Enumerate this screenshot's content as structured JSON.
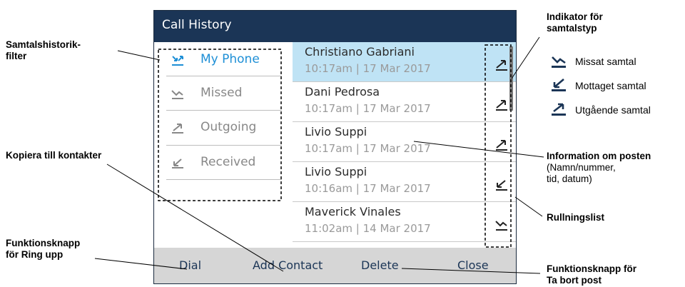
{
  "screen": {
    "title": "Call History",
    "filters": [
      {
        "label": "My Phone",
        "icon": "all-calls-icon",
        "active": true
      },
      {
        "label": "Missed",
        "icon": "missed-call-icon",
        "active": false
      },
      {
        "label": "Outgoing",
        "icon": "outgoing-call-icon",
        "active": false
      },
      {
        "label": "Received",
        "icon": "received-call-icon",
        "active": false
      }
    ],
    "entries": [
      {
        "name": "Christiano Gabriani",
        "time": "10:17am | 17 Mar 2017",
        "type": "outgoing-call-icon"
      },
      {
        "name": "Dani Pedrosa",
        "time": "10:17am | 17 Mar 2017",
        "type": "outgoing-call-icon"
      },
      {
        "name": "Livio Suppi",
        "time": "10:17am | 17 Mar 2017",
        "type": "outgoing-call-icon"
      },
      {
        "name": "Livio Suppi",
        "time": "10:16am | 17 Mar 2017",
        "type": "received-call-icon"
      },
      {
        "name": "Maverick Vinales",
        "time": "11:02am | 14 Mar 2017",
        "type": "missed-call-icon"
      }
    ],
    "softkeys": {
      "dial": "Dial",
      "add_contact": "Add Contact",
      "delete": "Delete",
      "close": "Close"
    },
    "colors": {
      "titlebar": "#1b3556",
      "selected_row": "#bfe3f5",
      "active_filter": "#1e8fd6",
      "softkey_bar": "#d6d6d6"
    }
  },
  "annotations": {
    "filter_l1": "Samtalshistorik-",
    "filter_l2": "filter",
    "copy": "Kopiera till kontakter",
    "dial_l1": "Funktionsknapp",
    "dial_l2": "för Ring upp",
    "indicator_l1": "Indikator för",
    "indicator_l2": "samtalstyp",
    "info_l1": "Information om posten",
    "info_l2": "(Namn/nummer,",
    "info_l3": "tid, datum)",
    "scroll": "Rullningslist",
    "delete_l1": "Funktionsknapp för",
    "delete_l2": "Ta bort post"
  },
  "legend": [
    {
      "label": "Missat samtal",
      "icon": "missed-call-icon"
    },
    {
      "label": "Mottaget samtal",
      "icon": "received-call-icon"
    },
    {
      "label": "Utgående samtal",
      "icon": "outgoing-call-icon"
    }
  ]
}
